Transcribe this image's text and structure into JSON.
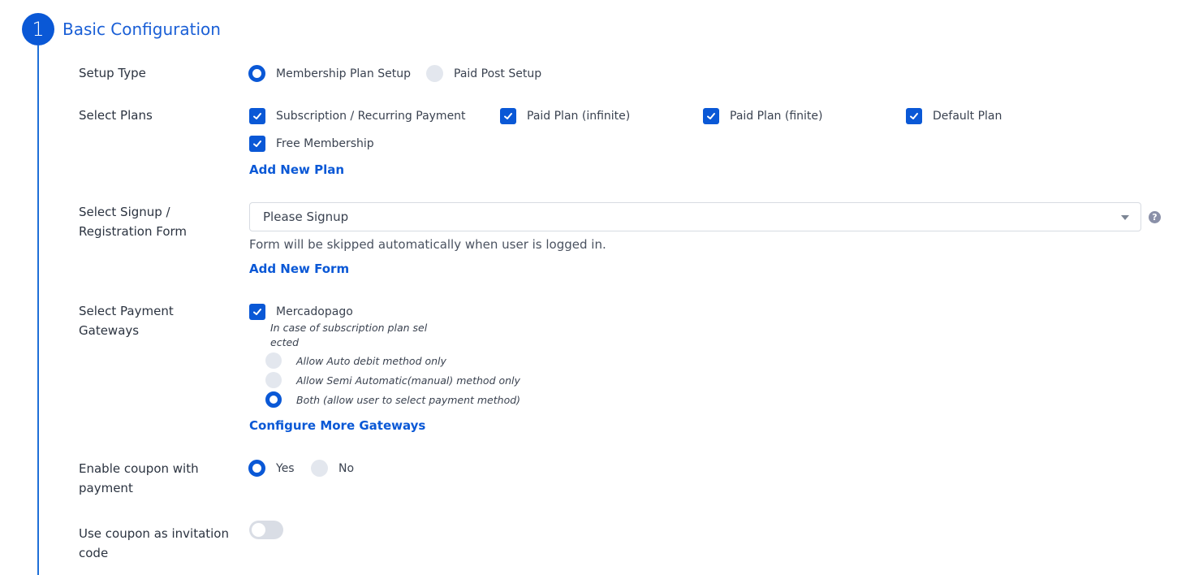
{
  "step": {
    "number": "1",
    "title": "Basic Configuration"
  },
  "setup_type": {
    "label": "Setup Type",
    "options": [
      "Membership Plan Setup",
      "Paid Post Setup"
    ],
    "selected": "Membership Plan Setup"
  },
  "plans": {
    "label": "Select Plans",
    "items": [
      {
        "label": "Subscription / Recurring Payment",
        "checked": true
      },
      {
        "label": "Paid Plan (infinite)",
        "checked": true
      },
      {
        "label": "Paid Plan (finite)",
        "checked": true
      },
      {
        "label": "Default Plan",
        "checked": true
      },
      {
        "label": "Free Membership",
        "checked": true
      }
    ],
    "add_link": "Add New Plan"
  },
  "signup": {
    "label_line1": "Select Signup /",
    "label_line2": "Registration Form",
    "selected": "Please Signup",
    "help_icon": "question-icon",
    "hint": "Form will be skipped automatically when user is logged in.",
    "add_link": "Add New Form"
  },
  "gateways": {
    "label_line1": "Select Payment",
    "label_line2": "Gateways",
    "gateway": {
      "label": "Mercadopago",
      "checked": true
    },
    "note_line1": "In case of subscription plan sel",
    "note_line2": "ected",
    "methods": [
      {
        "label": "Allow Auto debit method only",
        "selected": false
      },
      {
        "label": "Allow Semi Automatic(manual) method only",
        "selected": false
      },
      {
        "label": "Both (allow user to select payment method)",
        "selected": true
      }
    ],
    "configure_link": "Configure More Gateways"
  },
  "coupon": {
    "label_line1": "Enable coupon with",
    "label_line2": "payment",
    "options": [
      "Yes",
      "No"
    ],
    "selected": "Yes"
  },
  "invitation": {
    "label_line1": "Use coupon as invitation",
    "label_line2": "code",
    "enabled": false
  },
  "colors": {
    "accent": "#0a58d6",
    "line": "#1f6fd8",
    "radio_off": "#e3e7ee"
  }
}
